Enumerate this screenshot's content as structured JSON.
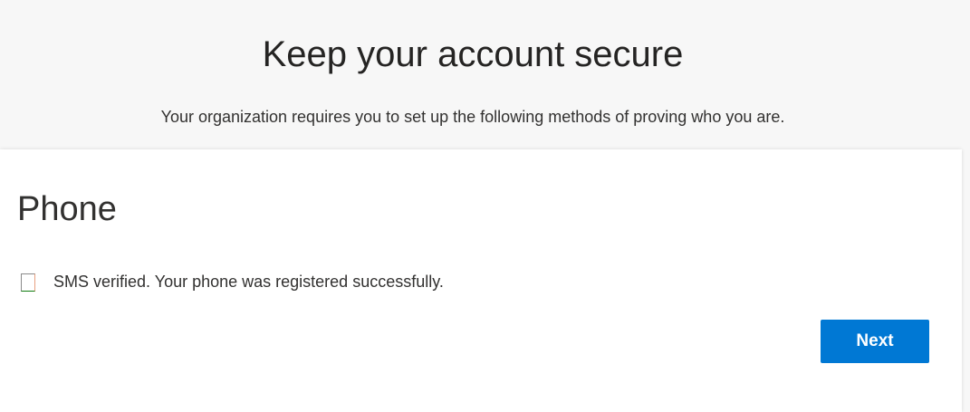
{
  "header": {
    "title": "Keep your account secure",
    "subtitle": "Your organization requires you to set up the following methods of proving who you are."
  },
  "card": {
    "title": "Phone",
    "status_icon": "status-square-icon",
    "status_text": "SMS verified. Your phone was registered successfully.",
    "next_label": "Next"
  },
  "colors": {
    "accent": "#0078d4",
    "background": "#f7f7f7"
  }
}
